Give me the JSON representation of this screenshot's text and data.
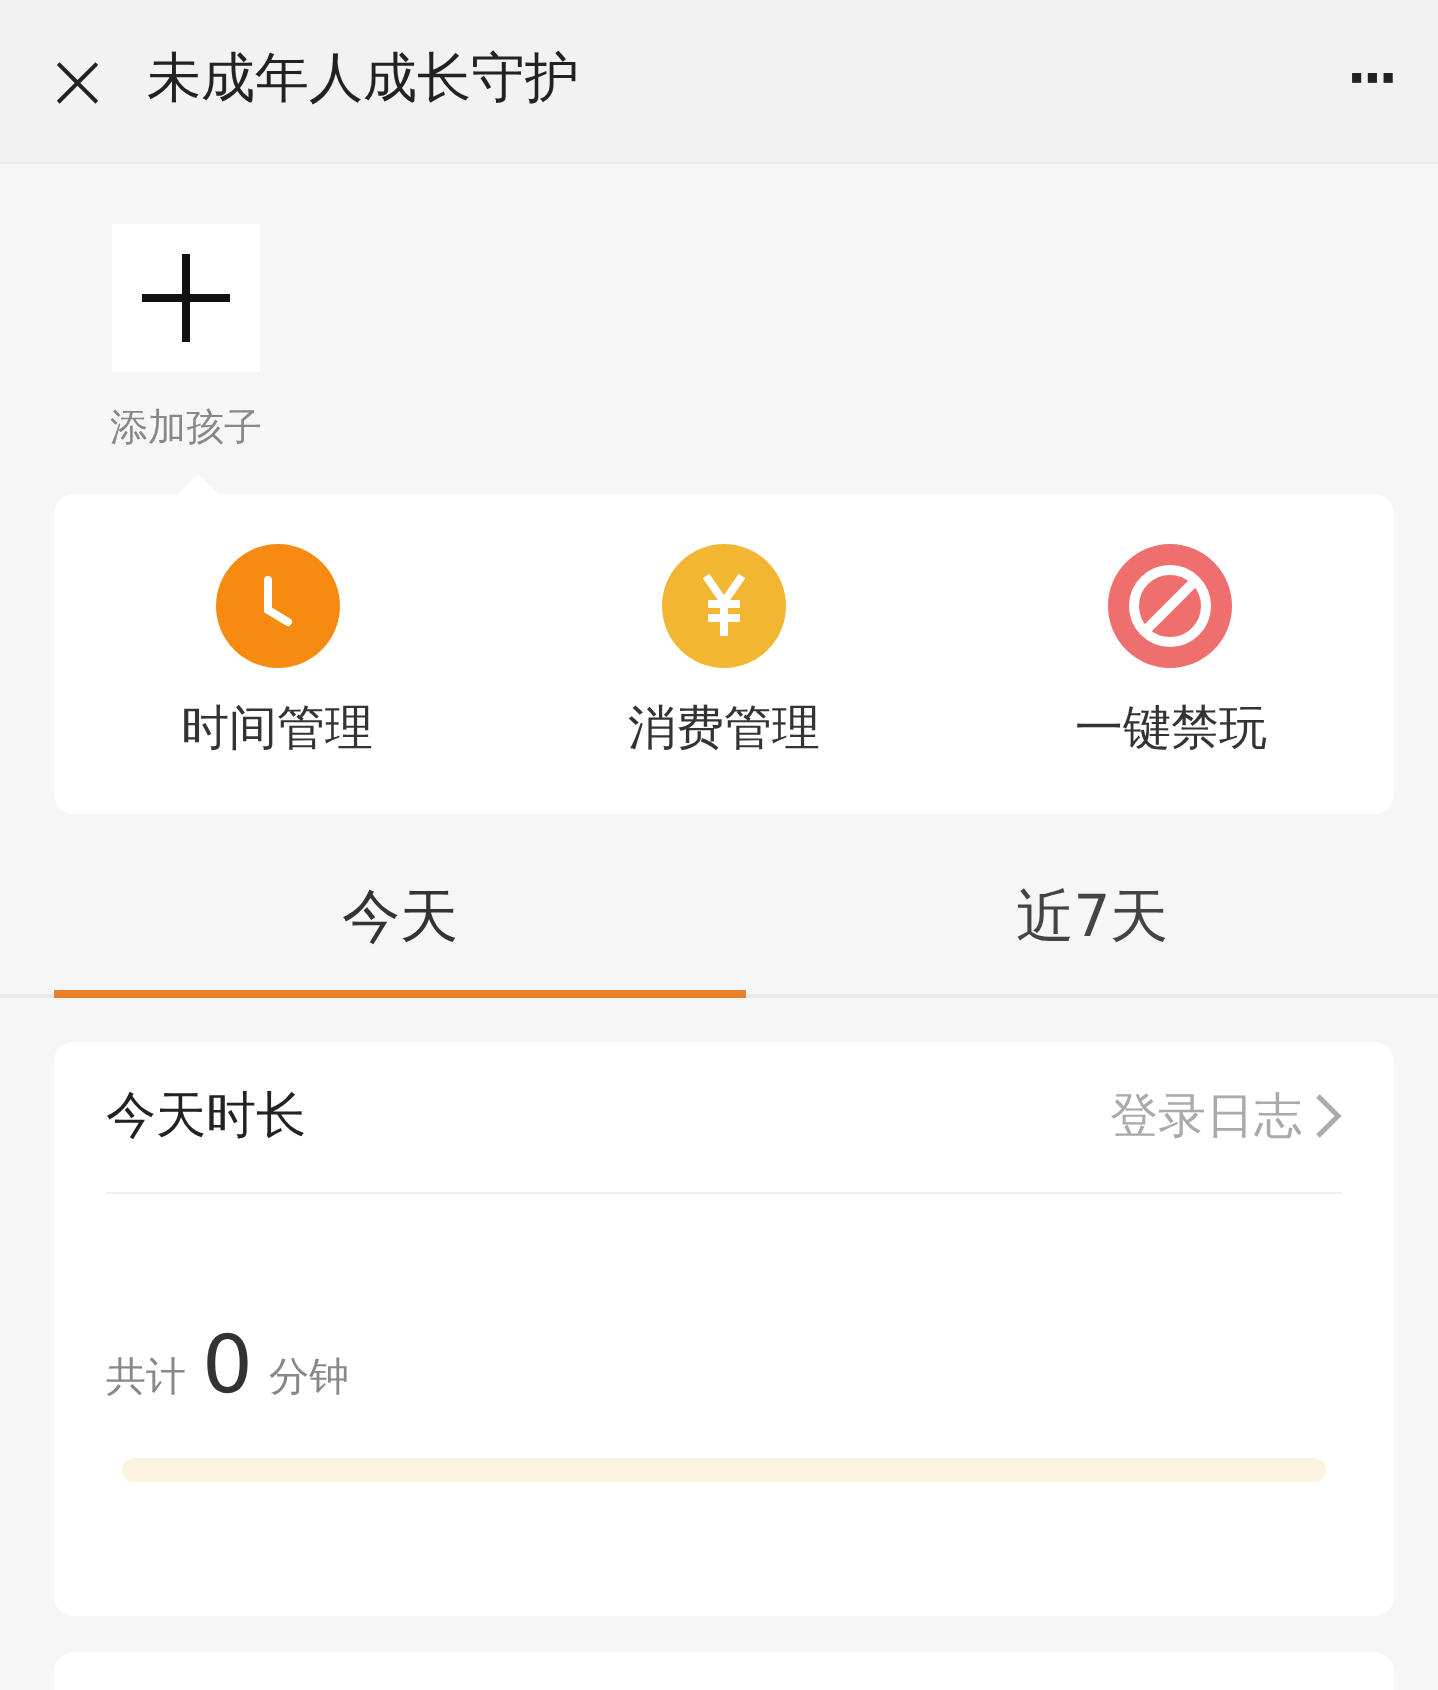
{
  "header": {
    "close_glyph": "×",
    "title": "未成年人成长守护",
    "more_glyph": "···"
  },
  "children_area": {
    "add_label": "添加孩子"
  },
  "actions": [
    {
      "kind": "clock",
      "label": "时间管理",
      "color": "#f78b12"
    },
    {
      "kind": "yen",
      "label": "消费管理",
      "color": "#f2b632"
    },
    {
      "kind": "ban",
      "label": "一键禁玩",
      "color": "#ef6e6e"
    }
  ],
  "tabs": [
    {
      "label": "今天",
      "selected": true
    },
    {
      "label": "近7天",
      "selected": false
    }
  ],
  "usage_card": {
    "title": "今天时长",
    "link": "登录日志",
    "total_prefix": "共计",
    "total_value": "0",
    "total_unit": "分钟",
    "level": 0
  }
}
